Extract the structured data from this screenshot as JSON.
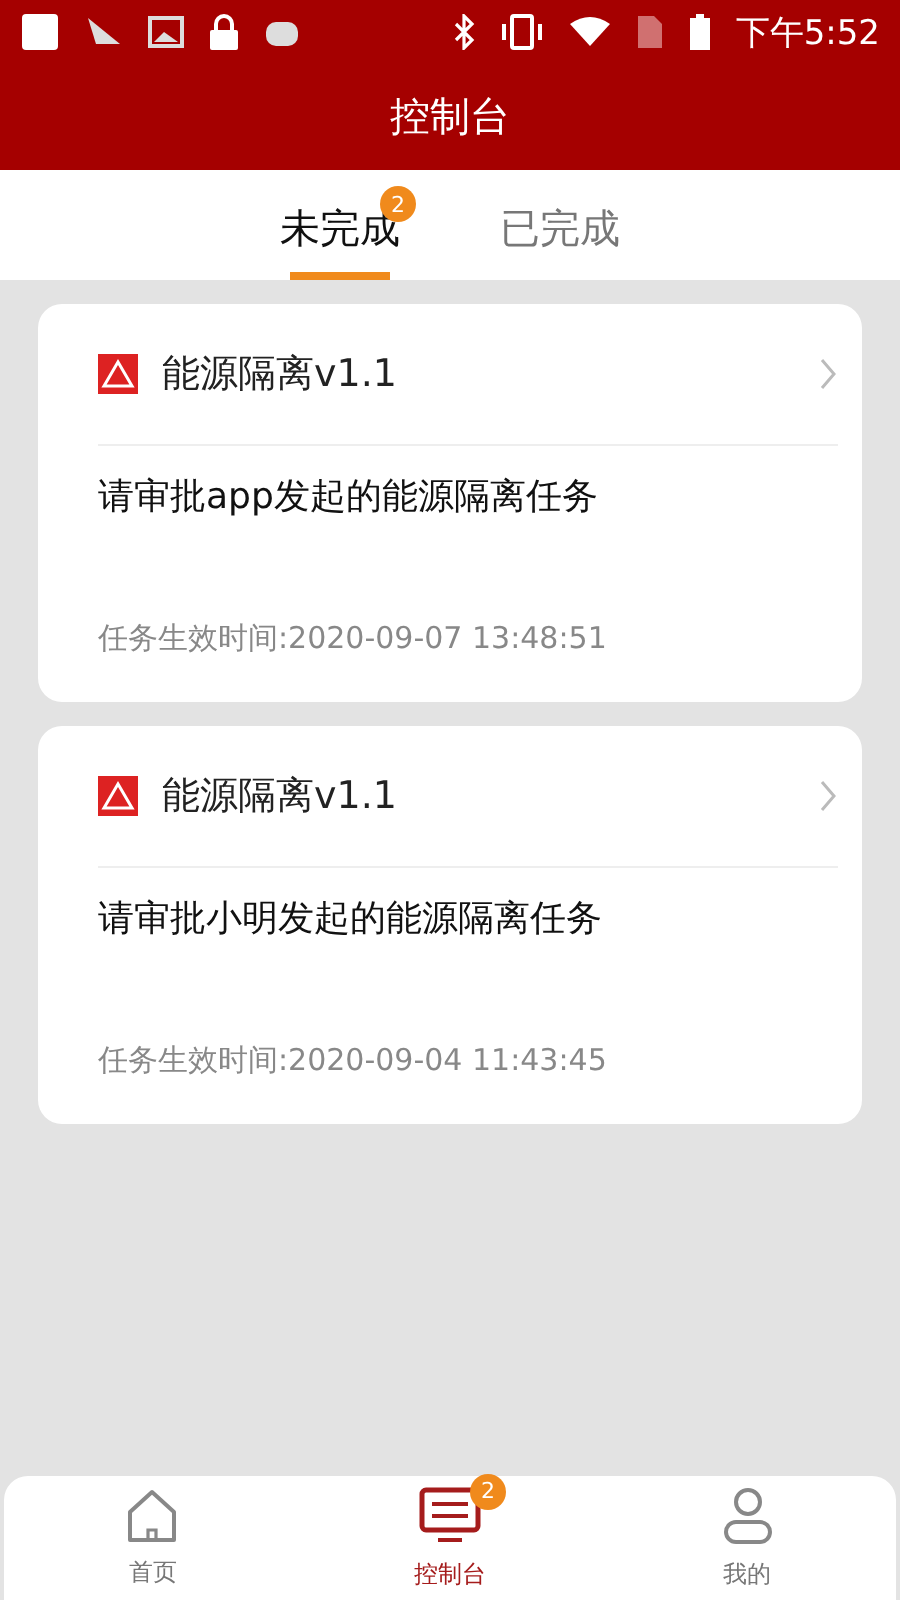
{
  "status_bar": {
    "time": "下午5:52"
  },
  "header": {
    "title": "控制台"
  },
  "tabs": [
    {
      "label": "未完成",
      "selected": true,
      "badge": "2"
    },
    {
      "label": "已完成",
      "selected": false
    }
  ],
  "tasks": [
    {
      "title": "能源隔离v1.1",
      "description": "请审批app发起的能源隔离任务",
      "time": "任务生效时间:2020-09-07 13:48:51"
    },
    {
      "title": "能源隔离v1.1",
      "description": "请审批小明发起的能源隔离任务",
      "time": "任务生效时间:2020-09-04 11:43:45"
    }
  ],
  "bottom_nav": [
    {
      "kind": "home",
      "label": "首页",
      "selected": false
    },
    {
      "kind": "console",
      "label": "控制台",
      "selected": true,
      "badge": "2"
    },
    {
      "kind": "profile",
      "label": "我的",
      "selected": false
    }
  ]
}
